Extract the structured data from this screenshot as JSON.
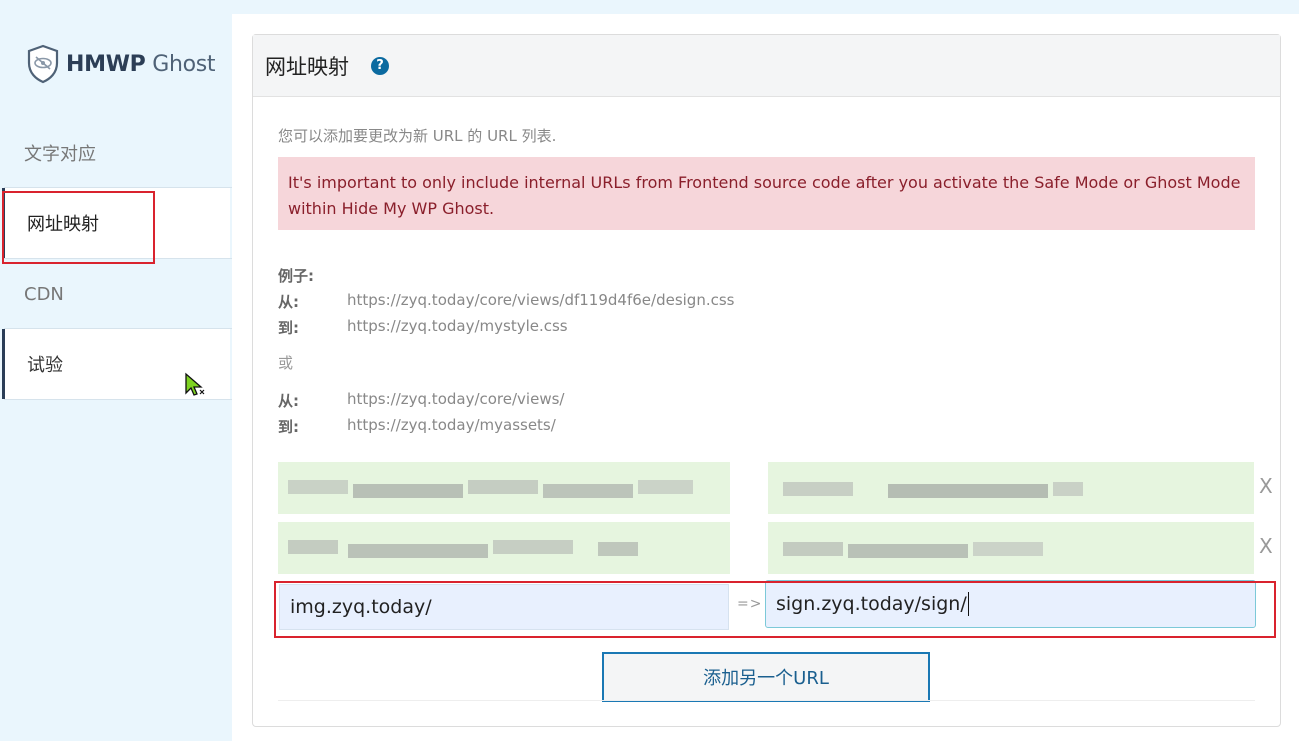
{
  "logo": {
    "brand_bold": "HMWP",
    "brand_light": "Ghost",
    "icon": "shield-eye-icon"
  },
  "sidebar": {
    "items": [
      {
        "label": "文字对应"
      },
      {
        "label": "网址映射"
      },
      {
        "label": "CDN"
      },
      {
        "label": "试验"
      }
    ]
  },
  "panel": {
    "title": "网址映射",
    "help_icon": "?",
    "description": "您可以添加要更改为新 URL 的 URL 列表.",
    "alert": "It's important to only include internal URLs from Frontend source code after you activate the Safe Mode or Ghost Mode within Hide My WP Ghost.",
    "examples": {
      "heading": "例子:",
      "from_label": "从:",
      "to_label": "到:",
      "ex1_from": "https://zyq.today/core/views/df119d4f6e/design.css",
      "ex1_to": "https://zyq.today/mystyle.css",
      "or": "或",
      "ex2_from": "https://zyq.today/core/views/",
      "ex2_to": "https://zyq.today/myassets/"
    },
    "mappings": [
      {
        "remove": "X"
      },
      {
        "remove": "X"
      }
    ],
    "new_mapping": {
      "from_value": "img.zyq.today/",
      "arrow": "=>",
      "to_value": "sign.zyq.today/sign/"
    },
    "add_button": "添加另一个URL"
  },
  "colors": {
    "accent": "#1a78b4",
    "alert_bg": "#f6d6da",
    "alert_text": "#8a1f2b",
    "highlight_red": "#d9232e"
  }
}
